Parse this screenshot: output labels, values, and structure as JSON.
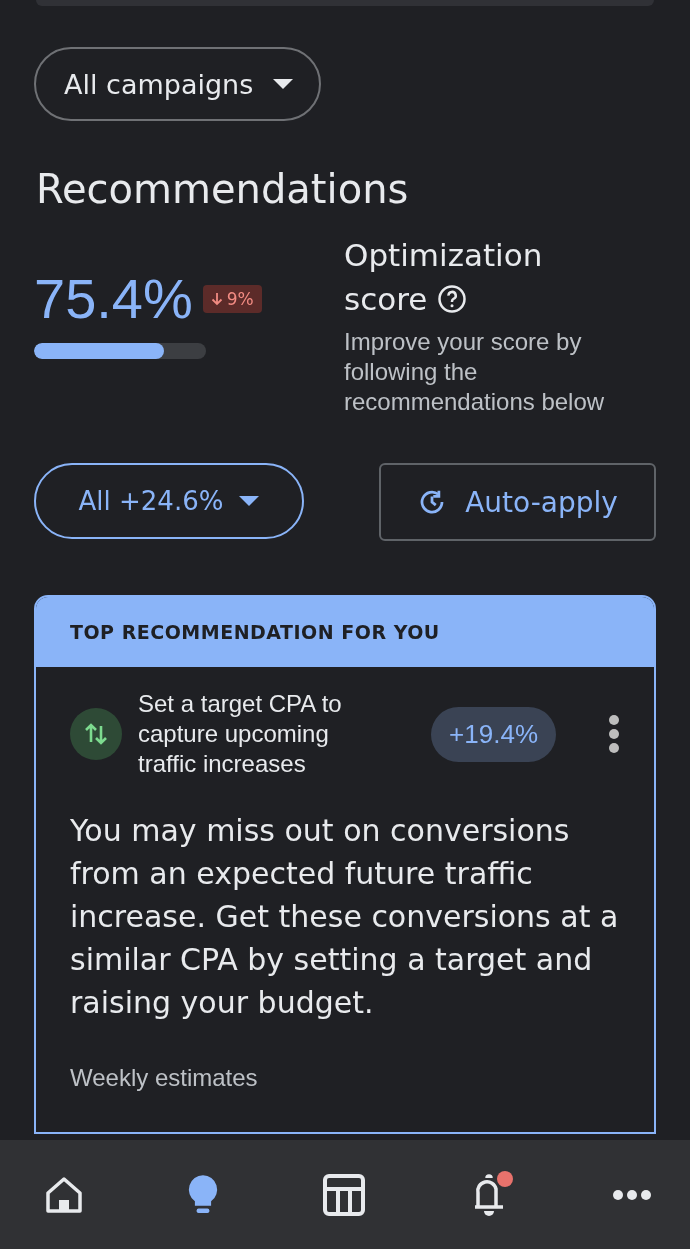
{
  "campaign_filter": {
    "label": "All campaigns"
  },
  "title": "Recommendations",
  "score": {
    "value": "75.4%",
    "change": "9%",
    "decrease": true,
    "level": 0.754,
    "heading_lines": [
      "Optimization",
      "score"
    ],
    "description": "Improve your score by following the recommendations below"
  },
  "filter_button": {
    "label": "All +24.6%"
  },
  "auto_apply_button": {
    "label": "Auto-apply"
  },
  "top_recommendation": {
    "header": "TOP RECOMMENDATION FOR YOU",
    "title": "Set a target CPA to capture upcoming traffic increases",
    "uplift": "+19.4%",
    "body": "You may miss out on conversions from an expected future traffic increase. Get these conversions at a similar CPA by setting a target and raising your budget.",
    "estimates_label": "Weekly estimates"
  },
  "bottom_nav": [
    {
      "kind": "home",
      "selected": false,
      "badge": false
    },
    {
      "kind": "recommendations",
      "selected": true,
      "badge": false
    },
    {
      "kind": "table",
      "selected": false,
      "badge": false
    },
    {
      "kind": "notifications",
      "selected": false,
      "badge": true
    },
    {
      "kind": "more",
      "selected": false,
      "badge": false
    }
  ]
}
